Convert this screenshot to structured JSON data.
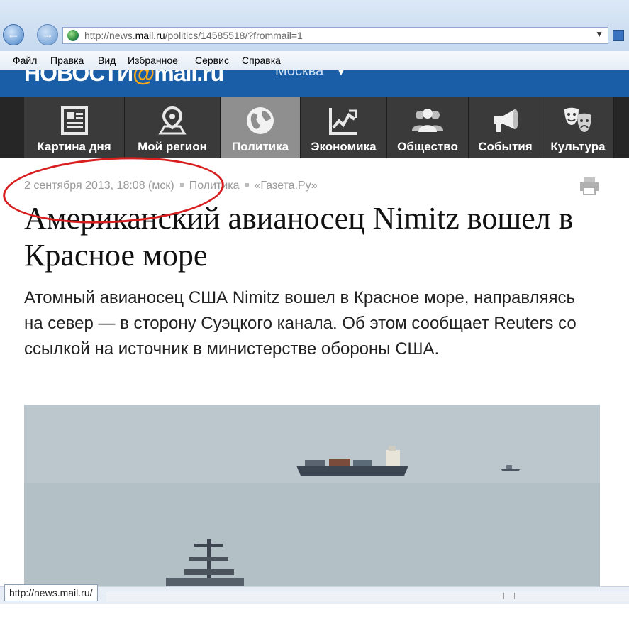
{
  "browser": {
    "url_prefix": "http://news.",
    "url_domain": "mail.ru",
    "url_path": "/politics/14585518/?frommail=1",
    "menu": [
      "Файл",
      "Правка",
      "Вид",
      "Избранное",
      "Сервис",
      "Справка"
    ],
    "status_tip": "http://news.mail.ru/"
  },
  "site": {
    "logo_left": "НОВОСТИ",
    "logo_at": "@",
    "logo_right": "mail.ru",
    "city": "Москва",
    "rubrics": [
      {
        "label": "Картина дня",
        "icon": "newspaper-icon"
      },
      {
        "label": "Мой регион",
        "icon": "map-pin-icon"
      },
      {
        "label": "Политика",
        "icon": "globe-icon"
      },
      {
        "label": "Экономика",
        "icon": "chart-icon"
      },
      {
        "label": "Общество",
        "icon": "people-icon"
      },
      {
        "label": "События",
        "icon": "megaphone-icon"
      },
      {
        "label": "Культура",
        "icon": "masks-icon"
      }
    ],
    "active_rubric": "Политика"
  },
  "article": {
    "date": "2 сентября 2013, 18:08 (мск)",
    "section": "Политика",
    "source": "«Газета.Ру»",
    "headline": "Американский авианосец Nimitz вошел в Красное море",
    "lead": "Атомный авианосец США Nimitz вошел в Красное море, направляясь на север — в сторону Суэцкого канала. Об этом сообщает Reuters со ссылкой на источник в министерстве обороны США."
  },
  "colors": {
    "site_blue": "#1b5ea8",
    "rubric_bg": "#3a3a3a",
    "rubric_active": "#8f8f8f",
    "annotation_red": "#d81e1e"
  }
}
